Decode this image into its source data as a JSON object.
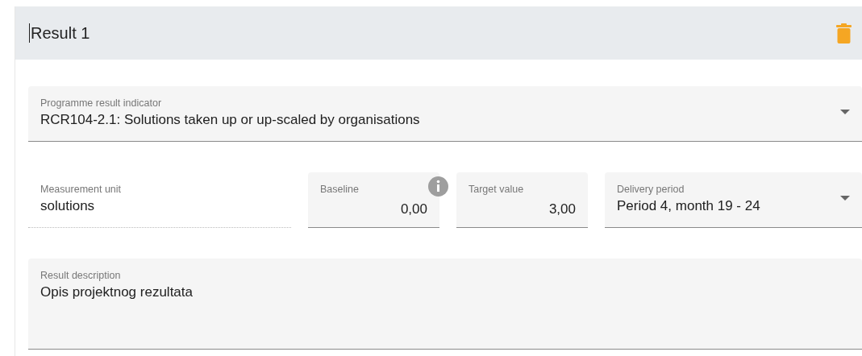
{
  "card": {
    "title": "Result 1"
  },
  "rows": [
    [
      {
        "kind": "select",
        "label": "Programme result indicator",
        "value": "RCR104-2.1: Solutions taken up or up-scaled by organisations"
      }
    ],
    [
      {
        "kind": "readonly",
        "label": "Measurement unit",
        "value": "solutions"
      },
      {
        "kind": "number",
        "label": "Baseline",
        "value": "0,00",
        "info": true
      },
      {
        "kind": "number",
        "label": "Target value",
        "value": "3,00",
        "info": false
      },
      {
        "kind": "select",
        "label": "Delivery period",
        "value": "Period 4, month 19 - 24"
      }
    ],
    [
      {
        "kind": "textarea",
        "label": "Result description",
        "value": "Opis projektnog rezultata"
      }
    ]
  ]
}
